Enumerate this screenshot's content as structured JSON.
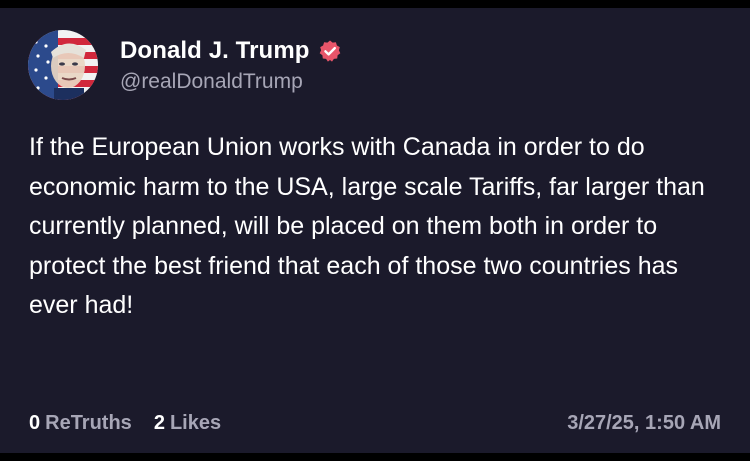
{
  "post": {
    "author": {
      "display_name": "Donald J. Trump",
      "handle": "@realDonaldTrump",
      "verified": true,
      "verified_icon": "verified-badge-icon",
      "avatar_icon": "profile-avatar"
    },
    "text": "If the European Union works with Canada in order to do economic harm to the USA, large scale Tariffs, far larger than currently planned, will be placed on them both in order to protect the best friend that each of those two countries has ever had!",
    "stats": {
      "retruths_count": "0",
      "retruths_label": "ReTruths",
      "likes_count": "2",
      "likes_label": "Likes"
    },
    "timestamp": "3/27/25, 1:50 AM"
  },
  "colors": {
    "background": "#1b1a2b",
    "text": "#ffffff",
    "muted": "#a7a6b6",
    "verified": "#e8556a"
  }
}
